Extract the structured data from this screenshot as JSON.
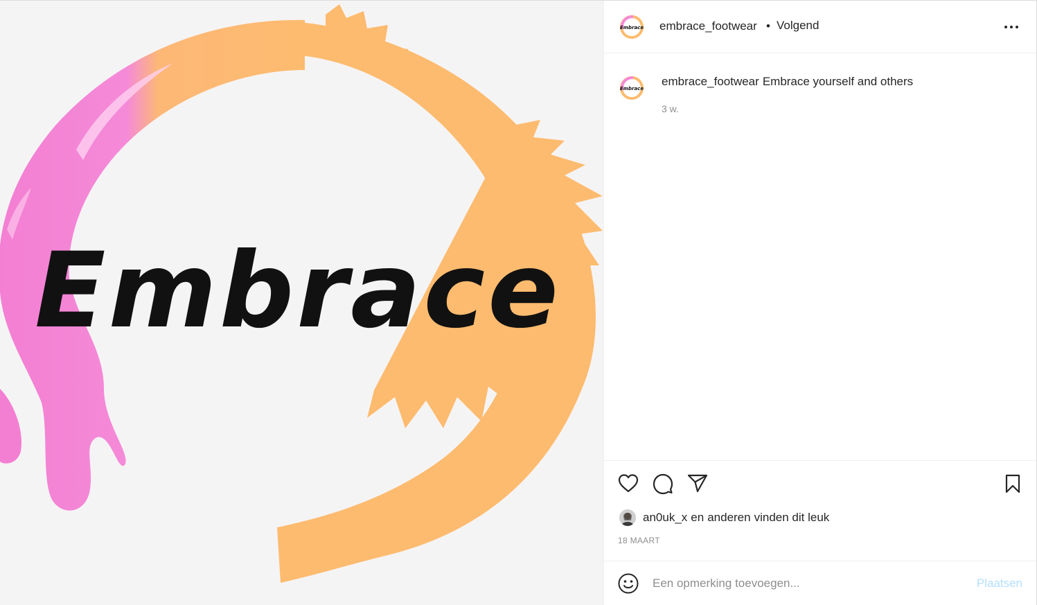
{
  "media": {
    "logo_text": "Embrace",
    "colors": {
      "background": "#f5f4f5",
      "pink": "#f48ad6",
      "orange": "#fdbb6f",
      "text": "#111111"
    }
  },
  "header": {
    "username": "embrace_footwear",
    "separator": "•",
    "follow_status": "Volgend",
    "avatar_icon": "embrace-logo-avatar",
    "more_icon": "more-options-icon"
  },
  "caption": {
    "username": "embrace_footwear",
    "text": "Embrace yourself and others",
    "time": "3 w."
  },
  "actions": {
    "like_icon": "heart-icon",
    "comment_icon": "comment-icon",
    "share_icon": "send-icon",
    "save_icon": "bookmark-icon"
  },
  "likes": {
    "user": "an0uk_x",
    "connector": "en",
    "others": "anderen",
    "suffix": "vinden dit leuk"
  },
  "date": "18 MAART",
  "comment": {
    "placeholder": "Een opmerking toevoegen...",
    "post_label": "Plaatsen",
    "post_color": "#b2dffc"
  }
}
